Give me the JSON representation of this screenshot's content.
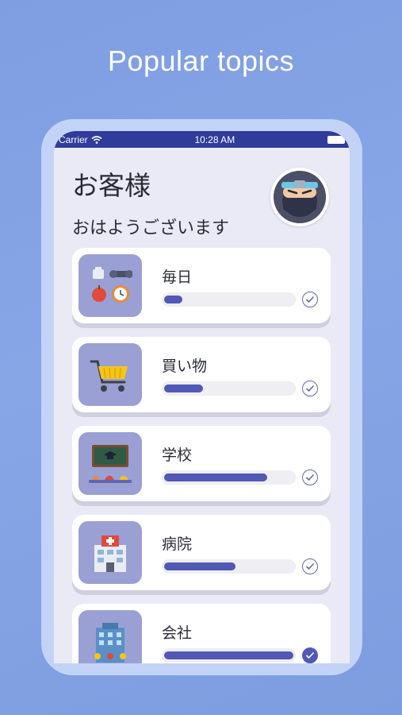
{
  "headline": "Popular topics",
  "status": {
    "carrier": "Carrier",
    "time": "10:28 AM"
  },
  "greeting": {
    "title": "お客様",
    "subtitle": "おはようございます"
  },
  "colors": {
    "accent": "#5158b5",
    "background": "#86a6e6",
    "statusbar": "#2f3c9a"
  },
  "topics": [
    {
      "label": "毎日",
      "icon": "daily-routine-icon",
      "progress": 0.14,
      "completed": false
    },
    {
      "label": "買い物",
      "icon": "shopping-cart-icon",
      "progress": 0.3,
      "completed": false
    },
    {
      "label": "学校",
      "icon": "classroom-icon",
      "progress": 0.8,
      "completed": false
    },
    {
      "label": "病院",
      "icon": "hospital-icon",
      "progress": 0.55,
      "completed": false
    },
    {
      "label": "会社",
      "icon": "office-building-icon",
      "progress": 1.0,
      "completed": true
    }
  ]
}
